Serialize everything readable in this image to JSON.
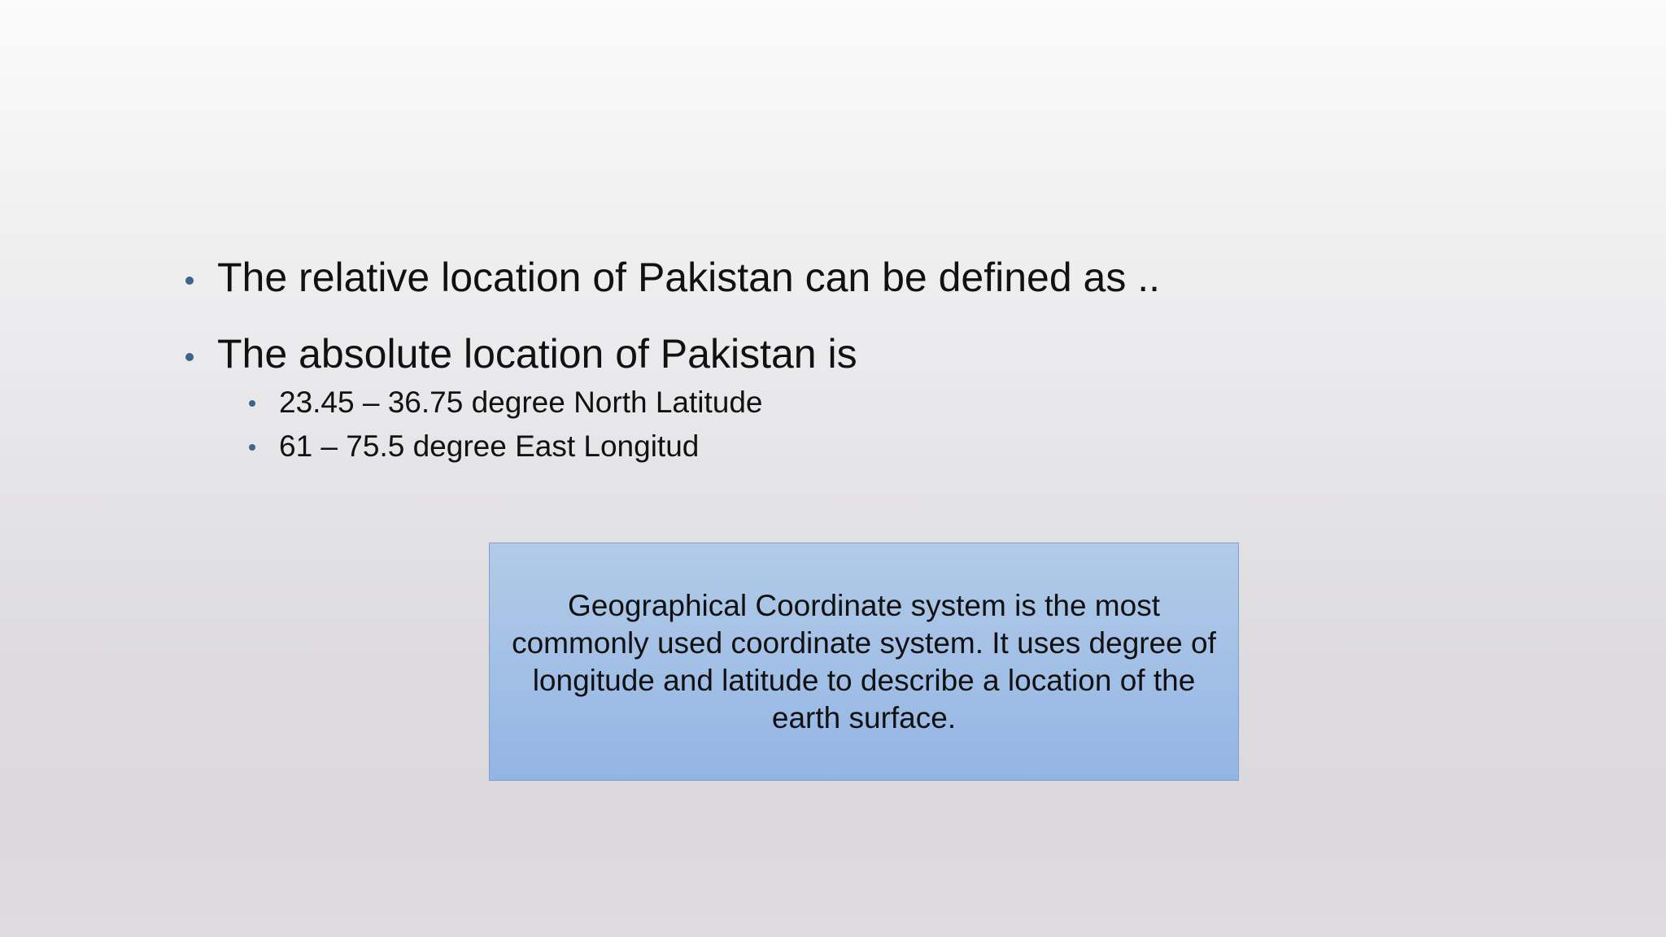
{
  "bullets": [
    {
      "text": "The relative location of Pakistan can be defined as ..",
      "sub_items": []
    },
    {
      "text": "The absolute location of Pakistan is",
      "sub_items": [
        "23.45 – 36.75 degree North Latitude",
        "61 – 75.5 degree East Longitud"
      ]
    }
  ],
  "info_box": {
    "text": "Geographical Coordinate system is the most commonly used coordinate system. It uses degree of longitude and latitude to describe a location of the earth surface."
  },
  "colors": {
    "bullet": "#3f6389",
    "box_fill": "#a3c0e6",
    "box_border": "#7f9fcf"
  }
}
